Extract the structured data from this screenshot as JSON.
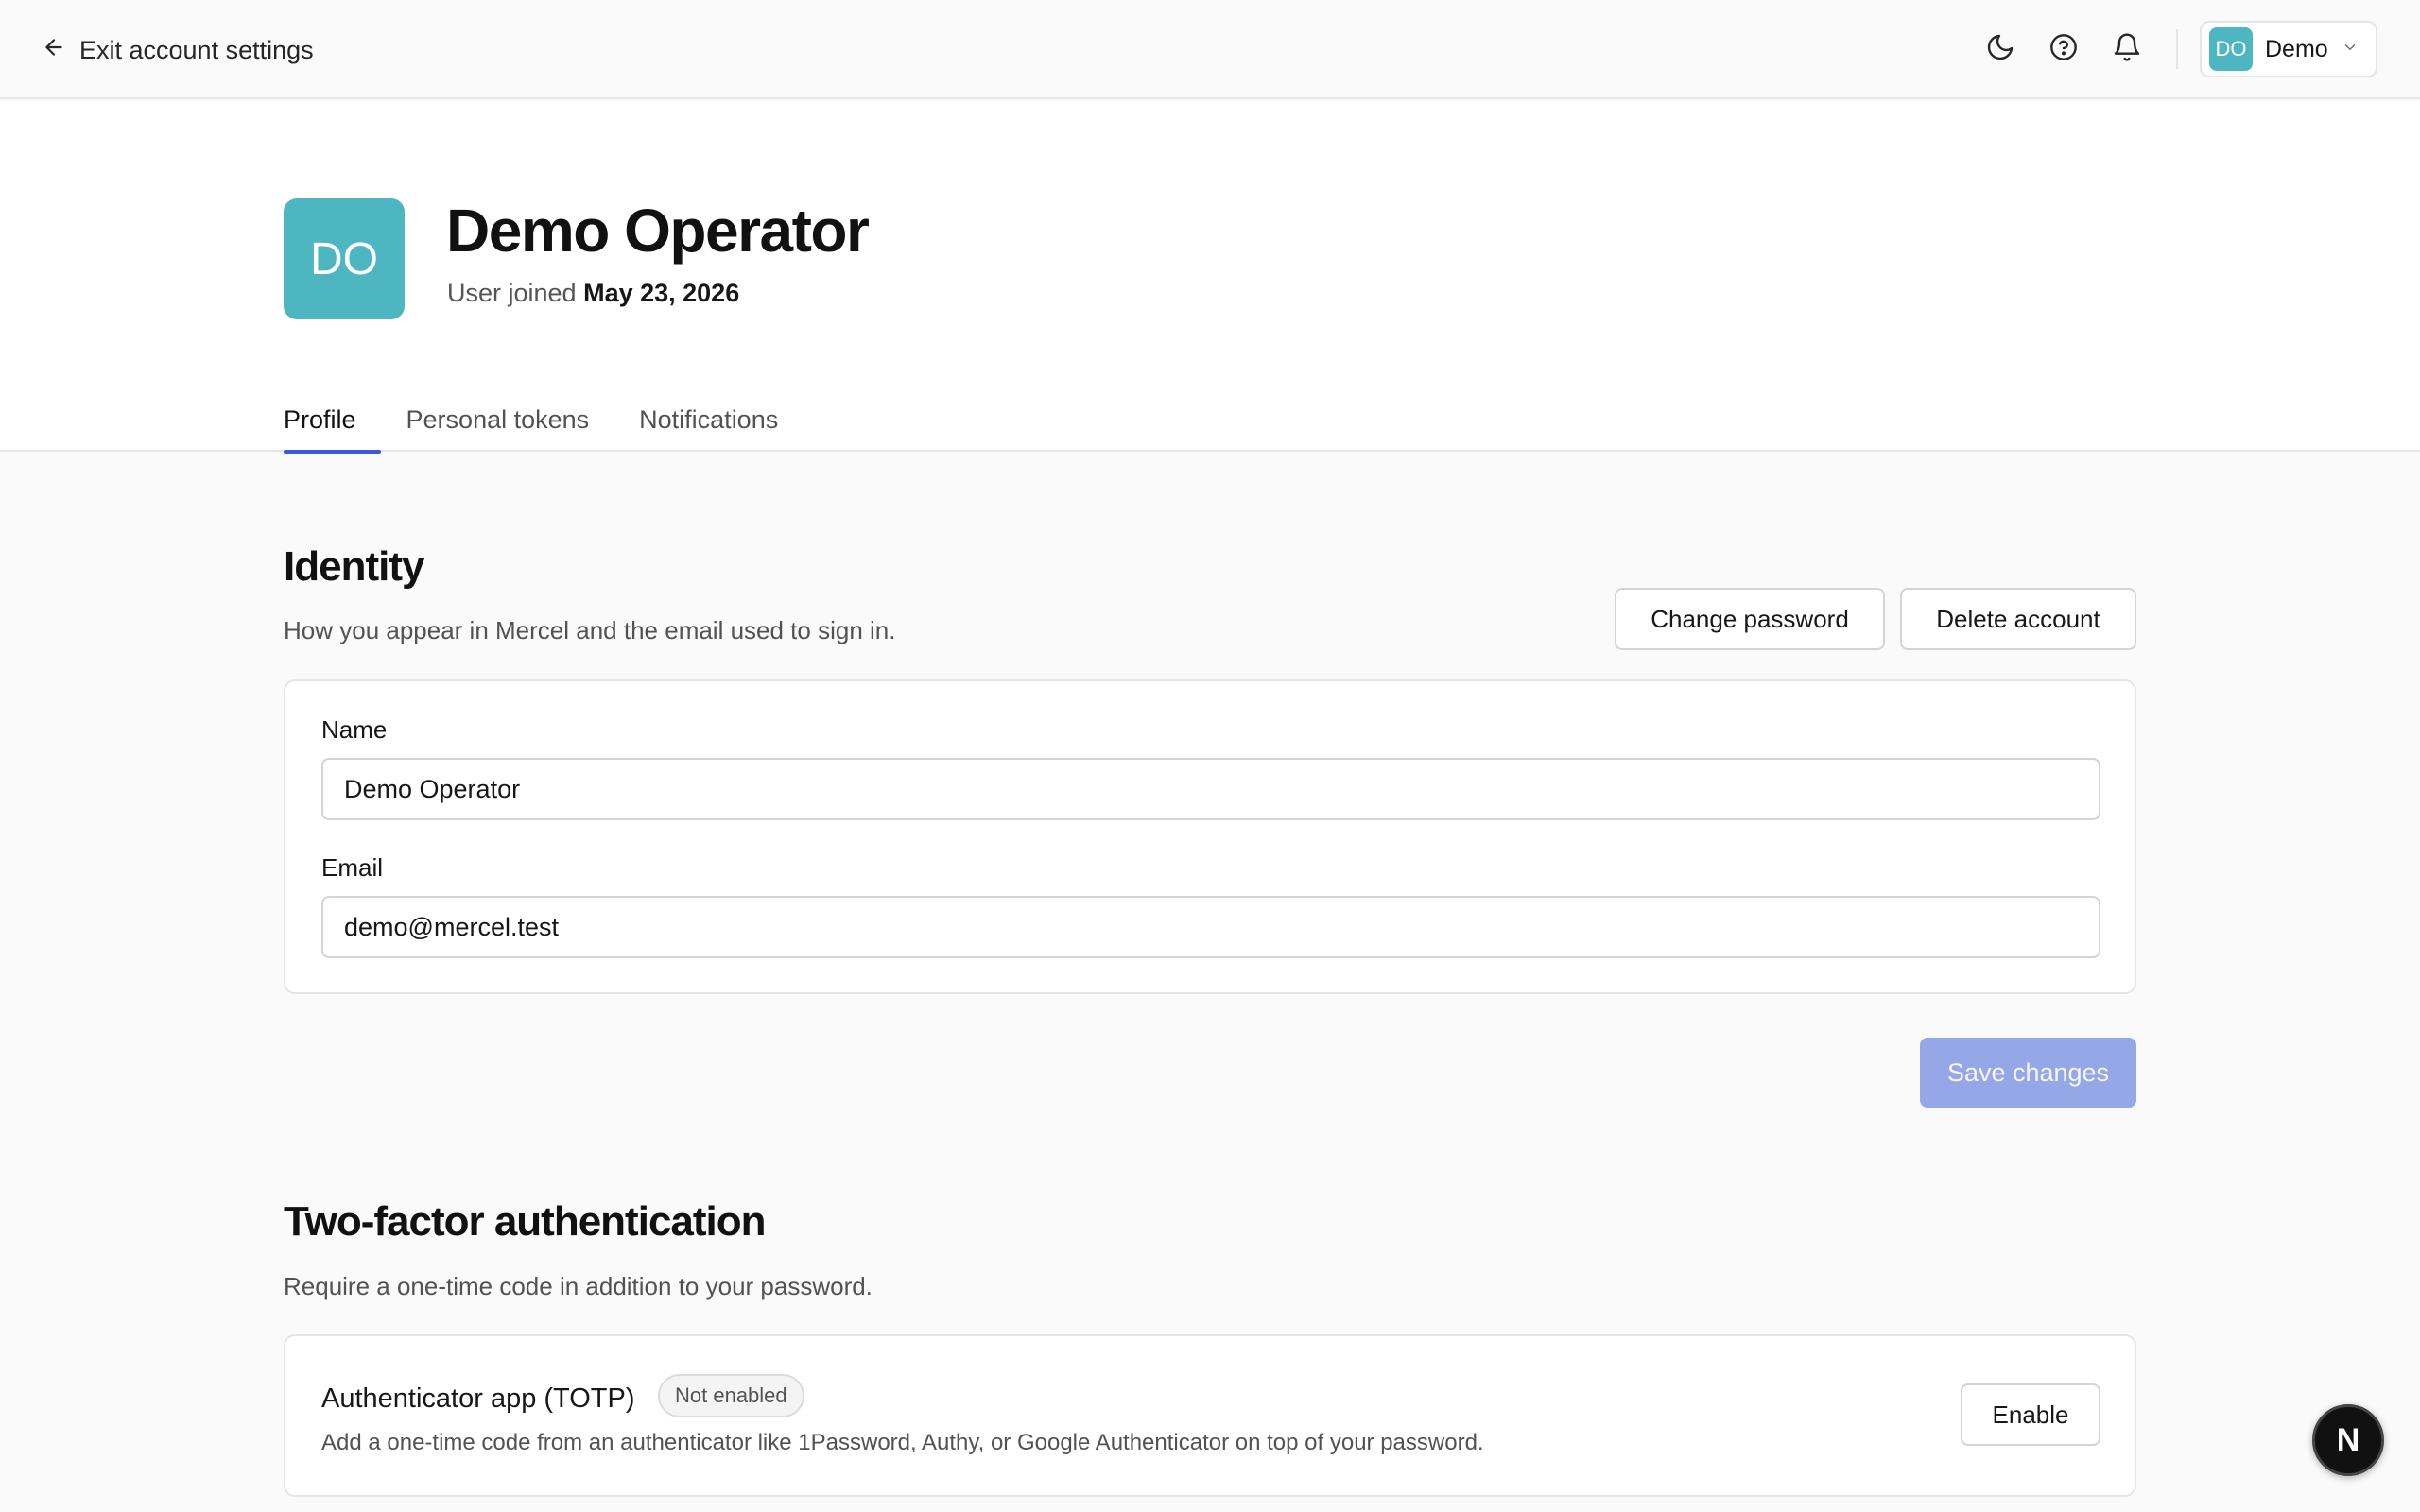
{
  "topbar": {
    "exit_label": "Exit account settings",
    "user_initials": "DO",
    "user_name": "Demo"
  },
  "profile": {
    "initials": "DO",
    "name": "Demo Operator",
    "joined_prefix": "User joined",
    "joined_date": "May 23, 2026"
  },
  "tabs": [
    {
      "label": "Profile",
      "active": true
    },
    {
      "label": "Personal tokens",
      "active": false
    },
    {
      "label": "Notifications",
      "active": false
    }
  ],
  "identity": {
    "title": "Identity",
    "description": "How you appear in Mercel and the email used to sign in.",
    "change_password_label": "Change password",
    "delete_account_label": "Delete account",
    "name_label": "Name",
    "name_value": "Demo Operator",
    "email_label": "Email",
    "email_value": "demo@mercel.test",
    "save_label": "Save changes"
  },
  "two_factor": {
    "title": "Two-factor authentication",
    "description": "Require a one-time code in addition to your password.",
    "totp_title": "Authenticator app (TOTP)",
    "totp_status": "Not enabled",
    "totp_description": "Add a one-time code from an authenticator like 1Password, Authy, or Google Authenticator on top of your password.",
    "enable_label": "Enable"
  },
  "fab": {
    "letter": "N"
  },
  "colors": {
    "accent": "#3b5bdb",
    "avatar": "#4db6c1",
    "save_disabled": "#95a7e6"
  },
  "icons": [
    "arrow-left-icon",
    "moon-icon",
    "help-circle-icon",
    "bell-icon",
    "chevron-down-icon"
  ]
}
